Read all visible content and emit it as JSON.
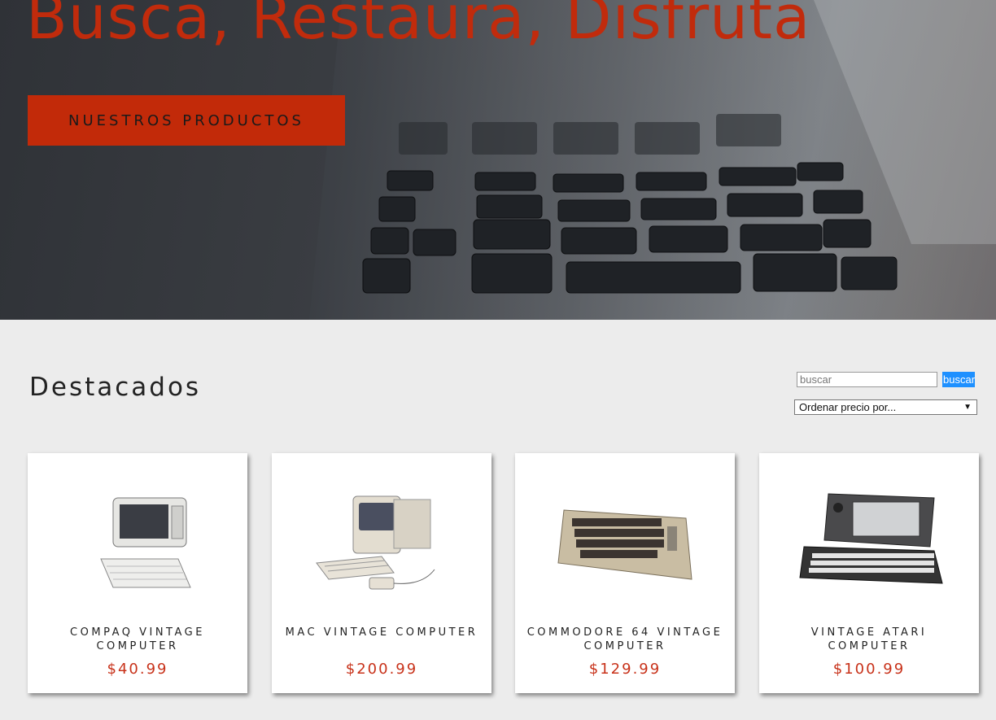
{
  "hero": {
    "title": "Busca, Restaura, Disfruta",
    "cta_label": "NUESTROS PRODUCTOS",
    "accent_color": "#c12b0c"
  },
  "featured": {
    "title": "Destacados"
  },
  "search": {
    "placeholder": "buscar",
    "button_label": "buscar"
  },
  "sort": {
    "selected": "Ordenar precio por..."
  },
  "products": [
    {
      "name": "COMPAQ VINTAGE COMPUTER",
      "price": "$40.99",
      "icon": "compaq-computer-image"
    },
    {
      "name": "MAC VINTAGE COMPUTER",
      "price": "$200.99",
      "icon": "mac-computer-image"
    },
    {
      "name": "COMMODORE 64 VINTAGE COMPUTER",
      "price": "$129.99",
      "icon": "commodore-computer-image"
    },
    {
      "name": "VINTAGE ATARI COMPUTER",
      "price": "$100.99",
      "icon": "atari-computer-image"
    }
  ]
}
